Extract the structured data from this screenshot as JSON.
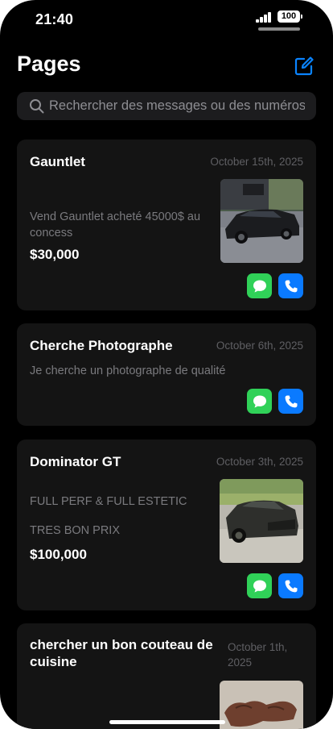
{
  "status": {
    "time": "21:40",
    "battery": "100"
  },
  "header": {
    "title": "Pages"
  },
  "search": {
    "placeholder": "Rechercher des messages ou des numéros"
  },
  "colors": {
    "accent": "#0a84ff",
    "message_green": "#30d158",
    "call_blue": "#0a7aff",
    "card_bg": "#141414",
    "background": "#000000"
  },
  "icons": {
    "compose": "compose-icon",
    "search": "search-icon",
    "message": "message-bubble-icon",
    "call": "phone-icon"
  },
  "posts": [
    {
      "title": "Gauntlet",
      "date": "October 15th, 2025",
      "description": "Vend Gauntlet acheté 45000$ au concess",
      "price": "$30,000",
      "image": "dark muscle car"
    },
    {
      "title": "Cherche Photographe",
      "date": "October 6th, 2025",
      "description": "Je cherche un photographe de qualité"
    },
    {
      "title": "Dominator GT",
      "date": "October 3th, 2025",
      "description_lines": [
        "FULL PERF & FULL ESTETIC",
        "TRES BON PRIX"
      ],
      "price": "$100,000",
      "image": "dark grey sports car"
    },
    {
      "title": "chercher un bon couteau de cuisine",
      "date": "October 1th, 2025",
      "image": "hand holding knife"
    }
  ]
}
